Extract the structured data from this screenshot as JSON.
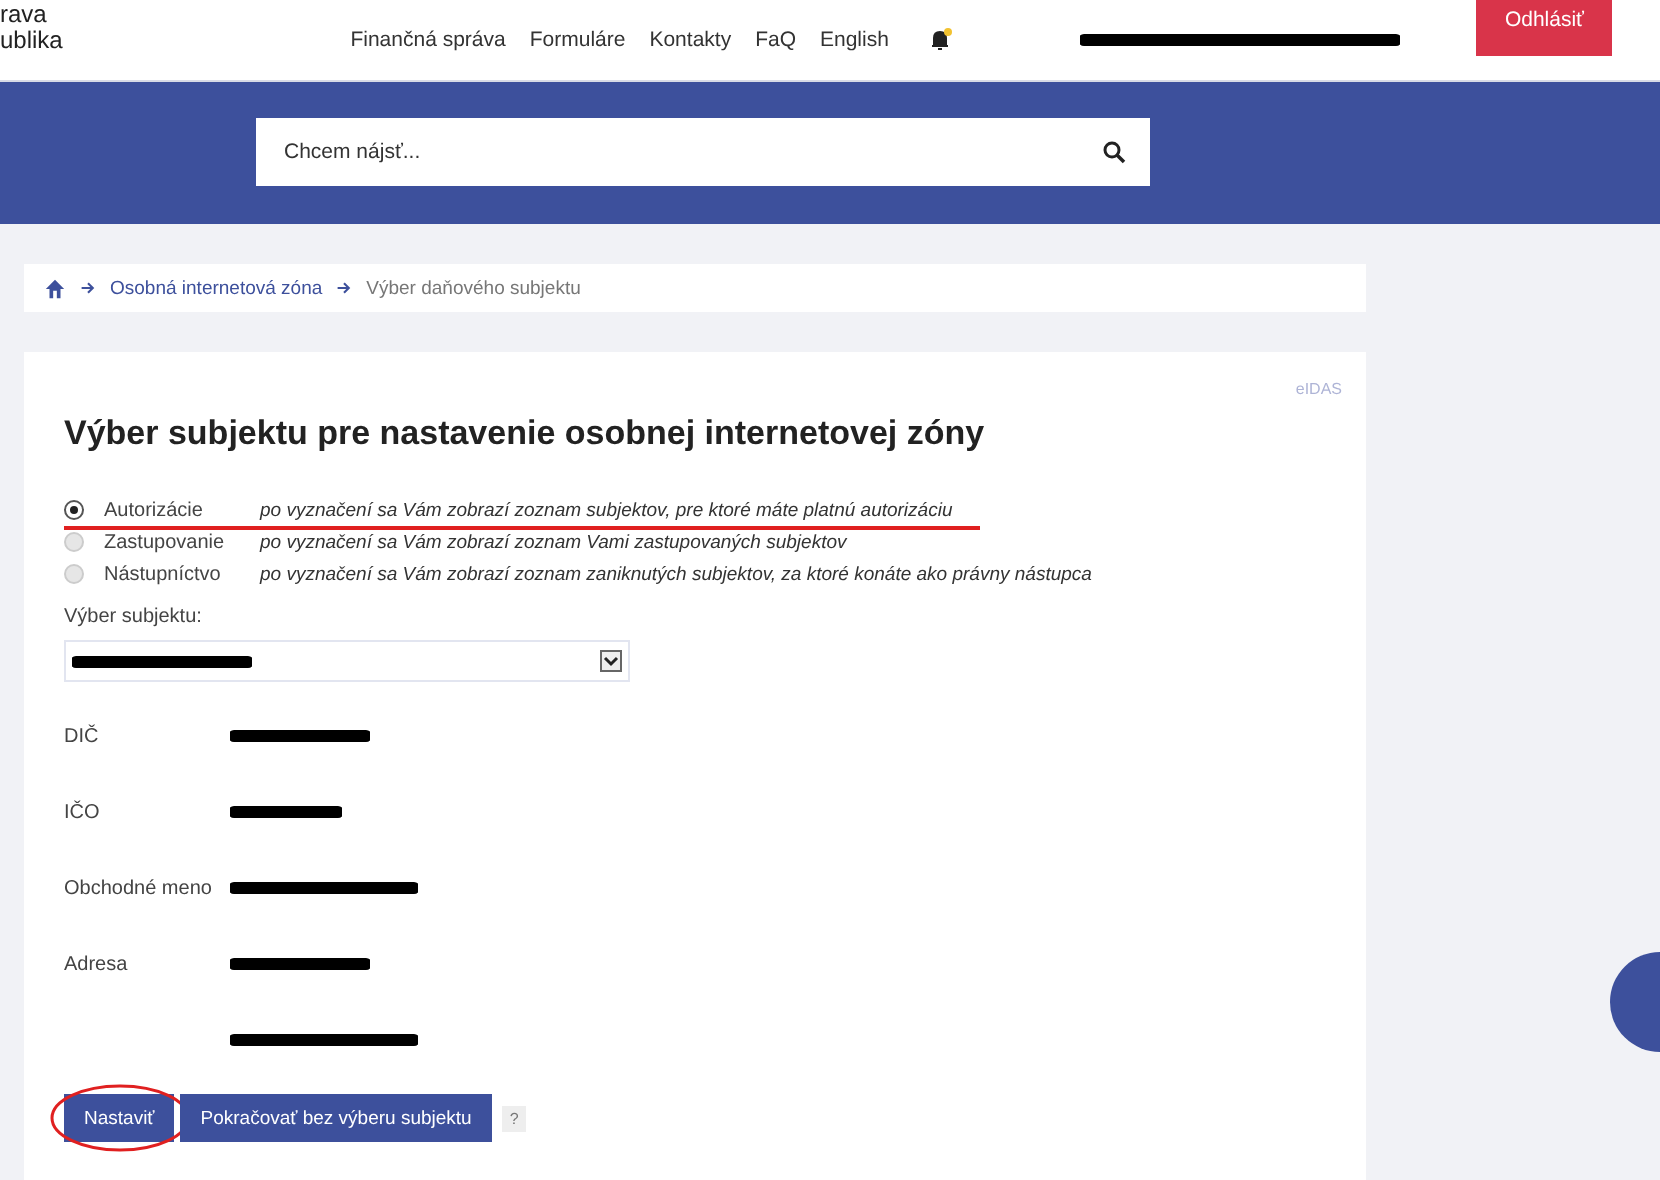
{
  "header": {
    "logo_lines": [
      "rava",
      "ublika"
    ],
    "nav": [
      "Finančná správa",
      "Formuláre",
      "Kontakty",
      "FaQ",
      "English"
    ],
    "notification": {
      "unread": true
    },
    "logout": "Odhlásiť"
  },
  "search": {
    "placeholder": "Chcem nájsť..."
  },
  "breadcrumb": [
    {
      "label": "Osobná internetová zóna",
      "kind": "link"
    },
    {
      "label": "Výber daňového subjektu",
      "kind": "current"
    }
  ],
  "card": {
    "badge": "eIDAS",
    "title": "Výber subjektu pre nastavenie osobnej internetovej zóny",
    "options": [
      {
        "label": "Autorizácie",
        "description": "po vyznačení sa Vám zobrazí zoznam subjektov, pre ktoré máte platnú autorizáciu",
        "selected": true,
        "underlined": true
      },
      {
        "label": "Zastupovanie",
        "description": "po vyznačení sa Vám zobrazí zoznam Vami zastupovaných subjektov",
        "selected": false,
        "underlined": false
      },
      {
        "label": "Nástupníctvo",
        "description": "po vyznačení sa Vám zobrazí zoznam zaniknutých subjektov, za ktoré konáte ako právny nástupca",
        "selected": false,
        "underlined": false
      }
    ],
    "select_label": "Výber subjektu:",
    "fields": [
      {
        "kind": "labeled",
        "label": "DIČ"
      },
      {
        "kind": "labeled",
        "label": "IČO"
      },
      {
        "kind": "labeled",
        "label": "Obchodné meno"
      },
      {
        "kind": "labeled",
        "label": "Adresa"
      },
      {
        "kind": "continuation"
      }
    ],
    "buttons": [
      {
        "label": "Nastaviť",
        "circled": true
      },
      {
        "label": "Pokračovať bez výberu subjektu",
        "circled": false
      }
    ],
    "help": "?"
  }
}
